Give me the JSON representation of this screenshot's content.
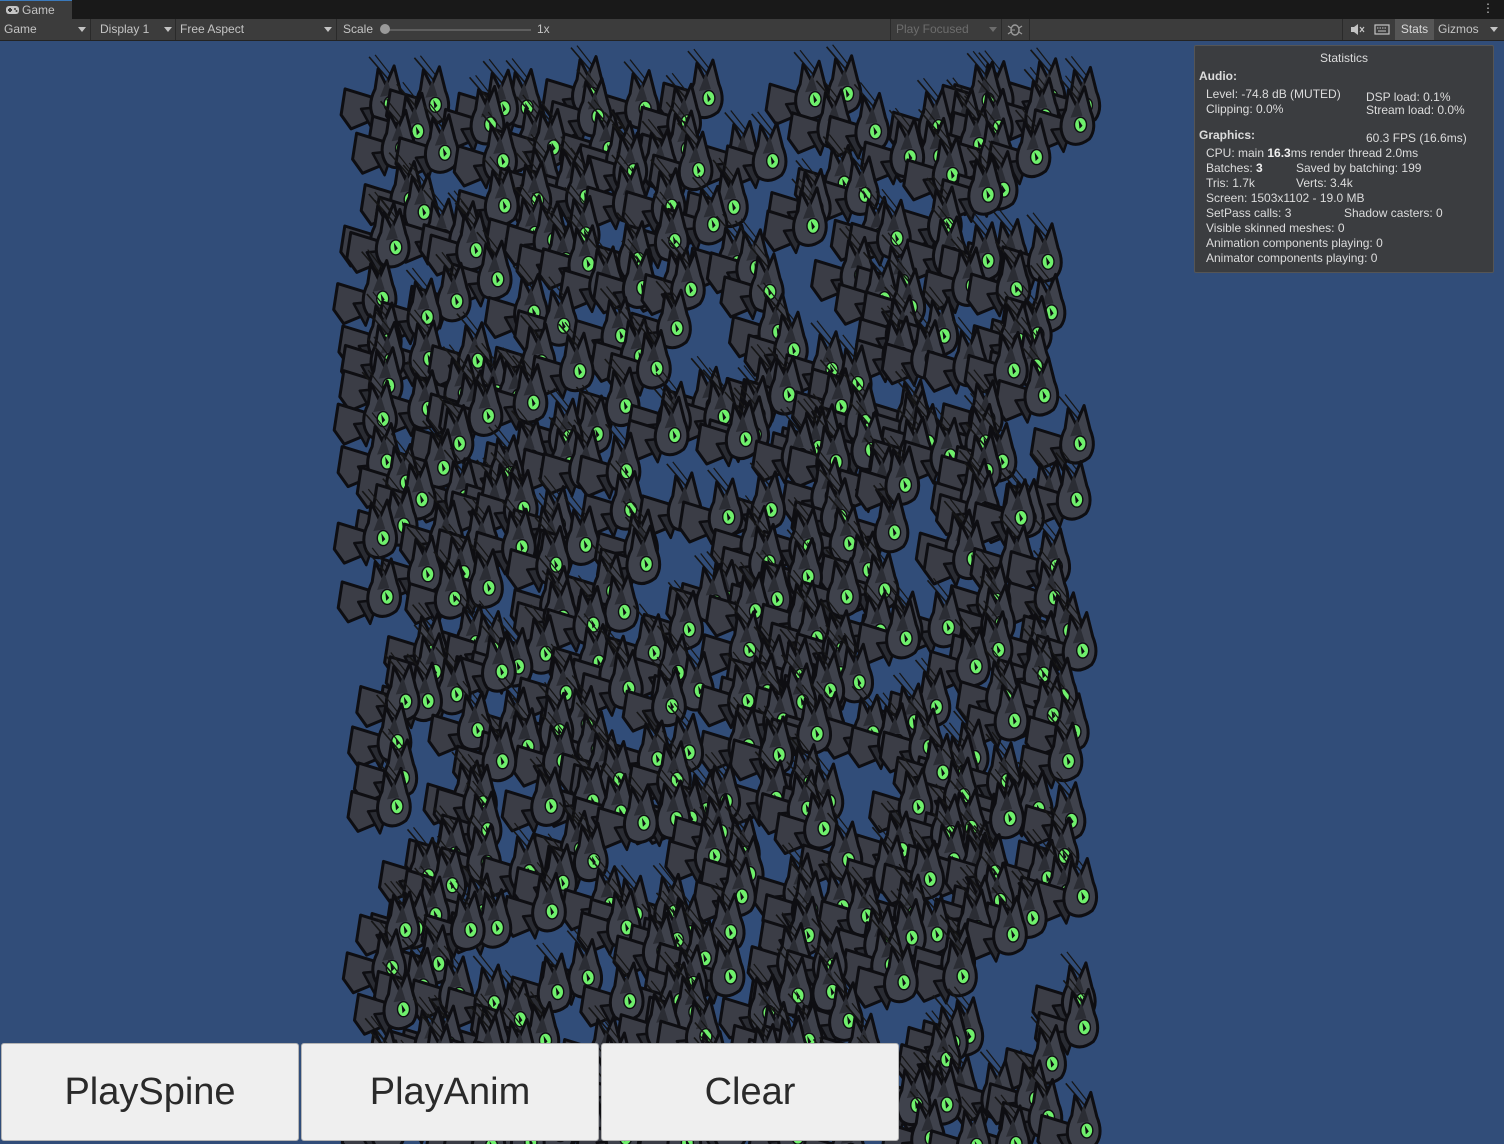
{
  "tab": {
    "label": "Game"
  },
  "toolbar": {
    "view_mode": "Game",
    "display": "Display 1",
    "aspect": "Free Aspect",
    "scale_label": "Scale",
    "scale_value": "1x",
    "scale_level": 0,
    "play_mode": "Play Focused",
    "stats_label": "Stats",
    "gizmos_label": "Gizmos"
  },
  "stats": {
    "title": "Statistics",
    "audio_header": "Audio:",
    "level": "Level: -74.8 dB (MUTED)",
    "clipping": "Clipping: 0.0%",
    "dsp_load": "DSP load: 0.1%",
    "stream_load": "Stream load: 0.0%",
    "graphics_header": "Graphics:",
    "fps": "60.3 FPS (16.6ms)",
    "cpu_prefix": "CPU: main ",
    "cpu_main": "16.3",
    "cpu_suffix": "ms  render thread 2.0ms",
    "batches_prefix": "Batches: ",
    "batches_value": "3",
    "saved_by_batching": "Saved by batching: 199",
    "tris": "Tris: 1.7k",
    "verts": "Verts: 3.4k",
    "screen": "Screen: 1503x1102 - 19.0 MB",
    "setpass": "SetPass calls: 3",
    "shadow_casters": "Shadow casters: 0",
    "skinned_meshes": "Visible skinned meshes: 0",
    "animation_components": "Animation components playing: 0",
    "animator_components": "Animator components playing: 0"
  },
  "buttons": {
    "play_spine": "PlaySpine",
    "play_anim": "PlayAnim",
    "clear": "Clear"
  },
  "colors": {
    "viewport_bg": "#314d79",
    "creature_body": "#3b3d46",
    "creature_eye": "#6ff06c",
    "editor_bg": "#3c3c3c"
  }
}
